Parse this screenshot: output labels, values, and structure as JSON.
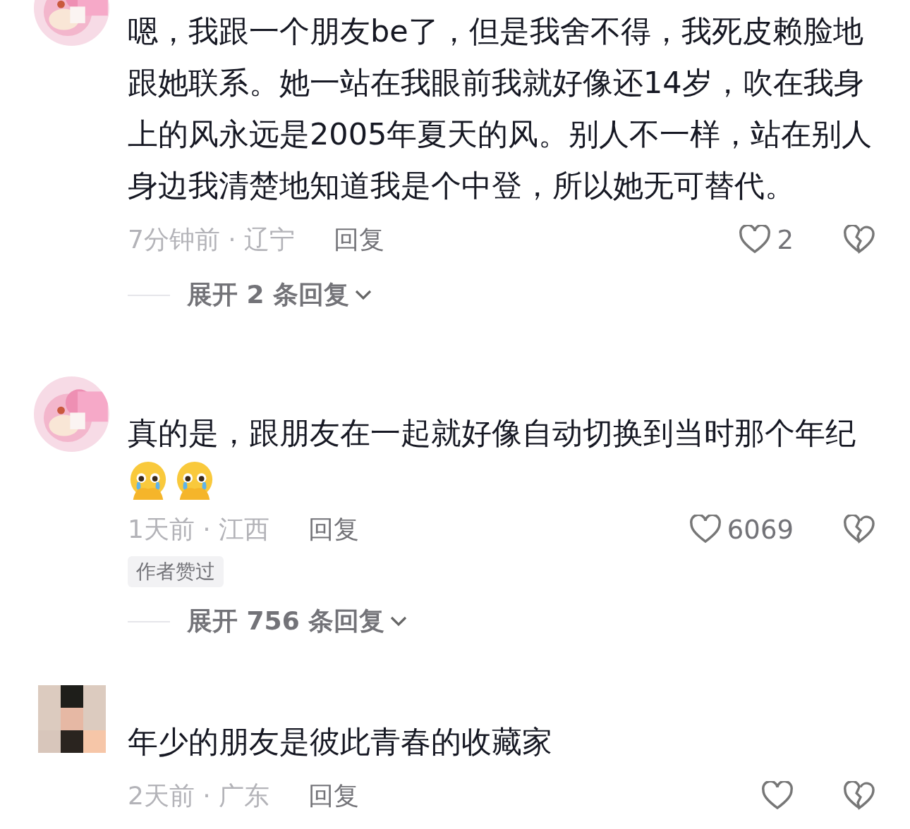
{
  "comments": [
    {
      "avatar": {
        "kind": "picture",
        "round": true
      },
      "text": "嗯，我跟一个朋友be了，但是我舍不得，我死皮赖脸地跟她联系。她一站在我眼前我就好像还14岁，吹在我身上的风永远是2005年夏天的风。别人不一样，站在别人身边我清楚地知道我是个中登，所以她无可替代。",
      "time": "7分钟前 · 辽宁",
      "reply": "回复",
      "likes": "2",
      "expand": "展开 2 条回复"
    },
    {
      "avatar": {
        "kind": "picture",
        "round": true
      },
      "text": "真的是，跟朋友在一起就好像自动切换到当时那个年纪",
      "emojis": [
        {
          "kind": "crying-face"
        },
        {
          "kind": "crying-face"
        }
      ],
      "time": "1天前 · 江西",
      "reply": "回复",
      "likes": "6069",
      "badge": "作者赞过",
      "expand": "展开 756 条回复"
    },
    {
      "avatar": {
        "kind": "picture",
        "round": false
      },
      "text": "年少的朋友是彼此青春的收藏家",
      "time": "2天前 · 广东",
      "reply": "回复"
    }
  ]
}
